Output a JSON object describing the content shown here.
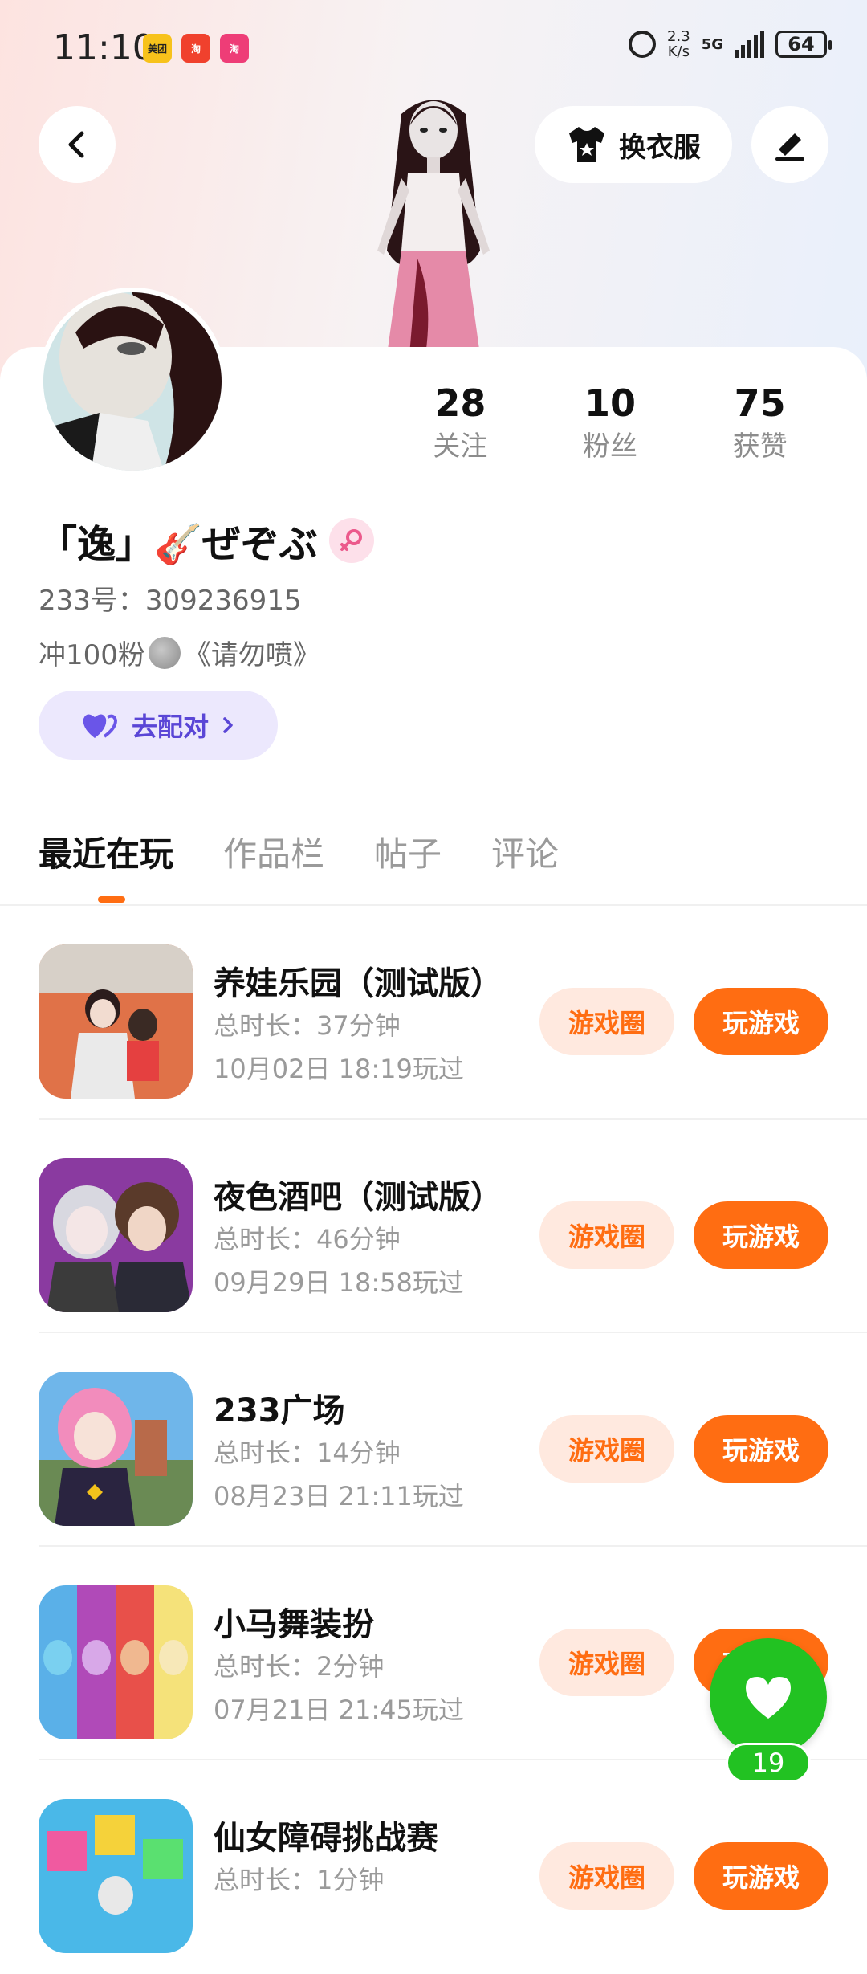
{
  "status_bar": {
    "time": "11:10",
    "notifications": [
      "美团",
      "淘",
      "淘"
    ],
    "net_speed_top": "2.3",
    "net_speed_bottom": "K/s",
    "network": "5G",
    "battery": "64"
  },
  "header": {
    "dress_up_label": "换衣服"
  },
  "profile": {
    "stats": [
      {
        "value": "28",
        "label": "关注"
      },
      {
        "value": "10",
        "label": "粉丝"
      },
      {
        "value": "75",
        "label": "获赞"
      }
    ],
    "nickname": "「逸」🎸ぜぞぶ",
    "uid": "233号：309236915",
    "bio_prefix": "冲100粉",
    "bio_suffix": "《请勿喷》",
    "match_label": "去配对"
  },
  "tabs": [
    {
      "label": "最近在玩",
      "active": true
    },
    {
      "label": "作品栏",
      "active": false
    },
    {
      "label": "帖子",
      "active": false
    },
    {
      "label": "评论",
      "active": false
    }
  ],
  "games": [
    {
      "title": "养娃乐园（测试版）",
      "duration": "总时长：37分钟",
      "last_played": "10月02日 18:19玩过",
      "circle_label": "游戏圈",
      "play_label": "玩游戏"
    },
    {
      "title": "夜色酒吧（测试版）",
      "duration": "总时长：46分钟",
      "last_played": "09月29日 18:58玩过",
      "circle_label": "游戏圈",
      "play_label": "玩游戏"
    },
    {
      "title": "233广场",
      "duration": "总时长：14分钟",
      "last_played": "08月23日 21:11玩过",
      "circle_label": "游戏圈",
      "play_label": "玩游戏"
    },
    {
      "title": "小马舞装扮",
      "duration": "总时长：2分钟",
      "last_played": "07月21日 21:45玩过",
      "circle_label": "游戏圈",
      "play_label": "玩游戏"
    },
    {
      "title": "仙女障碍挑战赛",
      "duration": "总时长：1分钟",
      "last_played": "",
      "circle_label": "游戏圈",
      "play_label": "玩游戏"
    }
  ],
  "floating_like": {
    "count": "19"
  },
  "colors": {
    "accent": "#ff6d12",
    "match": "#5a46d6",
    "like": "#22c222"
  }
}
